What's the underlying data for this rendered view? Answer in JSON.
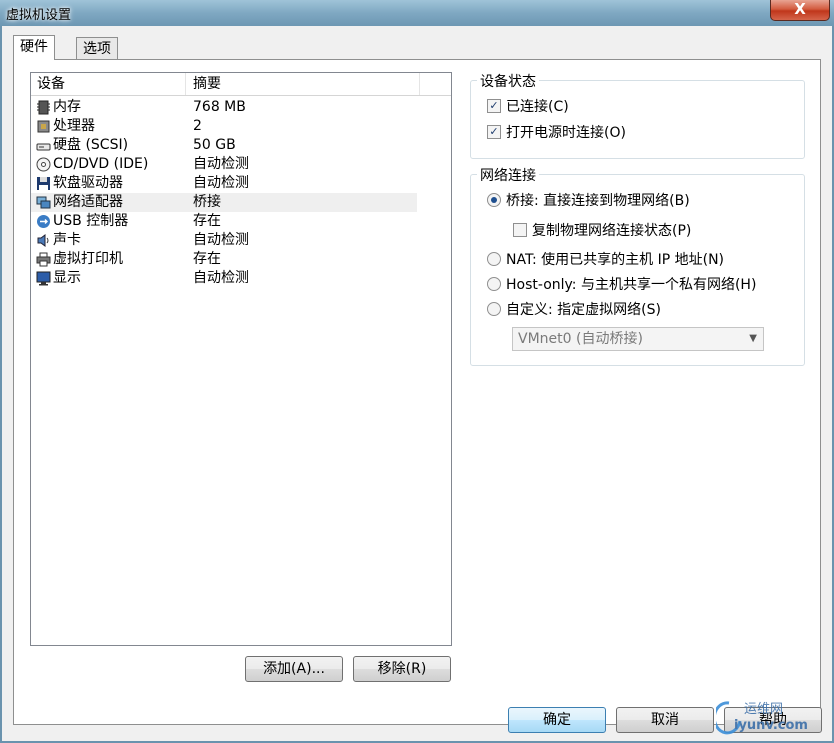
{
  "window": {
    "title": "虚拟机设置",
    "close_label": "X"
  },
  "tabs": [
    {
      "label": "硬件",
      "active": true
    },
    {
      "label": "选项",
      "active": false
    }
  ],
  "device_list": {
    "columns": [
      "设备",
      "摘要"
    ],
    "rows": [
      {
        "icon": "memory-icon",
        "name": "内存",
        "summary": "768 MB"
      },
      {
        "icon": "processor-icon",
        "name": "处理器",
        "summary": "2"
      },
      {
        "icon": "hard-disk-icon",
        "name": "硬盘 (SCSI)",
        "summary": "50 GB"
      },
      {
        "icon": "cd-dvd-icon",
        "name": "CD/DVD (IDE)",
        "summary": "自动检测"
      },
      {
        "icon": "floppy-icon",
        "name": "软盘驱动器",
        "summary": "自动检测"
      },
      {
        "icon": "network-adapter-icon",
        "name": "网络适配器",
        "summary": "桥接",
        "selected": true
      },
      {
        "icon": "usb-icon",
        "name": "USB 控制器",
        "summary": "存在"
      },
      {
        "icon": "sound-card-icon",
        "name": "声卡",
        "summary": "自动检测"
      },
      {
        "icon": "printer-icon",
        "name": "虚拟打印机",
        "summary": "存在"
      },
      {
        "icon": "display-icon",
        "name": "显示",
        "summary": "自动检测"
      }
    ]
  },
  "list_buttons": {
    "add": "添加(A)...",
    "remove": "移除(R)"
  },
  "device_status": {
    "title": "设备状态",
    "connected": {
      "label": "已连接(C)",
      "checked": true
    },
    "connect_at_power_on": {
      "label": "打开电源时连接(O)",
      "checked": true
    }
  },
  "network_connection": {
    "title": "网络连接",
    "bridged": {
      "label": "桥接: 直接连接到物理网络(B)",
      "selected": true
    },
    "replicate": {
      "label": "复制物理网络连接状态(P)",
      "checked": false
    },
    "nat": {
      "label": "NAT: 使用已共享的主机 IP 地址(N)",
      "selected": false
    },
    "host_only": {
      "label": "Host-only: 与主机共享一个私有网络(H)",
      "selected": false
    },
    "custom": {
      "label": "自定义: 指定虚拟网络(S)",
      "selected": false
    },
    "custom_select_value": "VMnet0 (自动桥接)"
  },
  "footer_buttons": {
    "ok": "确定",
    "cancel": "取消",
    "help": "帮助"
  },
  "watermark": {
    "line1": "运维网",
    "line2": "iyunv.com"
  }
}
